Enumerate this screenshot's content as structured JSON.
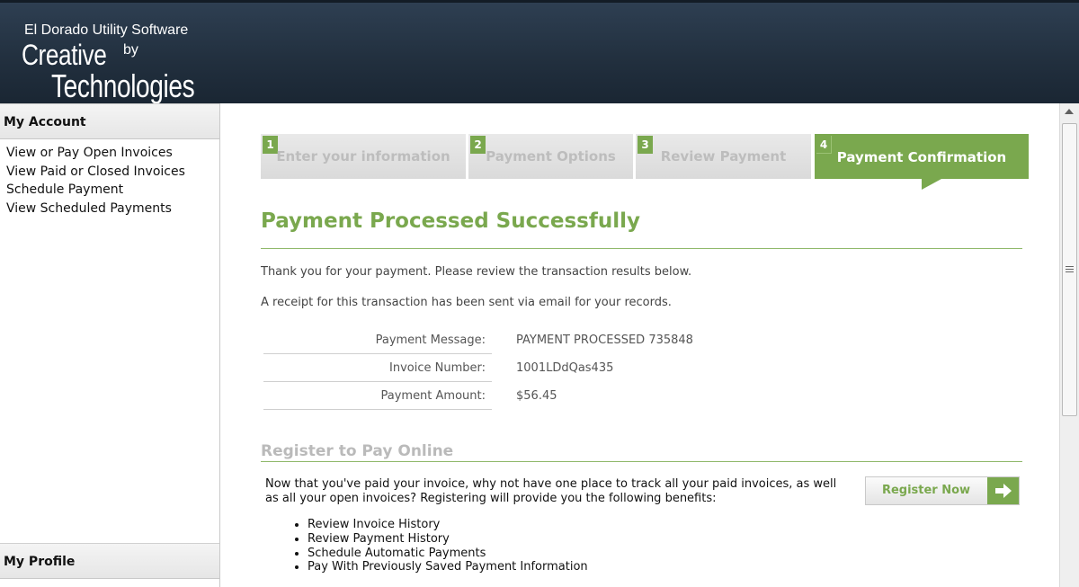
{
  "brand": {
    "line1": "El Dorado Utility Software",
    "creative": "Creative",
    "by": "by",
    "technologies": "Technologies"
  },
  "sidebar": {
    "account_heading": "My Account",
    "items": [
      {
        "label": "View or Pay Open Invoices"
      },
      {
        "label": "View Paid or Closed Invoices"
      },
      {
        "label": "Schedule Payment"
      },
      {
        "label": "View Scheduled Payments"
      }
    ],
    "profile_heading": "My Profile"
  },
  "steps": [
    {
      "num": "1",
      "label": "Enter your information"
    },
    {
      "num": "2",
      "label": "Payment Options"
    },
    {
      "num": "3",
      "label": "Review Payment"
    },
    {
      "num": "4",
      "label": "Payment Confirmation",
      "active": true
    }
  ],
  "main": {
    "title": "Payment Processed Successfully",
    "thanks": "Thank you for your payment. Please review the transaction results below.",
    "receipt": "A receipt for this transaction has been sent via email for your records.",
    "details": [
      {
        "label": "Payment Message:",
        "value": "PAYMENT PROCESSED 735848"
      },
      {
        "label": "Invoice Number:",
        "value": "1001LDdQas435"
      },
      {
        "label": "Payment Amount:",
        "value": "$56.45"
      }
    ],
    "register": {
      "title": "Register to Pay Online",
      "text": "Now that you've paid your invoice, why not have one place to track all your paid invoices, as well as all your open invoices? Registering will provide you the following benefits:",
      "benefits": [
        "Review Invoice History",
        "Review Payment History",
        "Schedule Automatic Payments",
        "Pay With Previously Saved Payment Information"
      ],
      "button_label": "Register Now"
    }
  },
  "colors": {
    "accent": "#7aa84e",
    "header": "#22303f"
  },
  "icons": {
    "register_arrow": "arrow-right-icon",
    "scroll_up": "scroll-up-arrow-icon"
  }
}
